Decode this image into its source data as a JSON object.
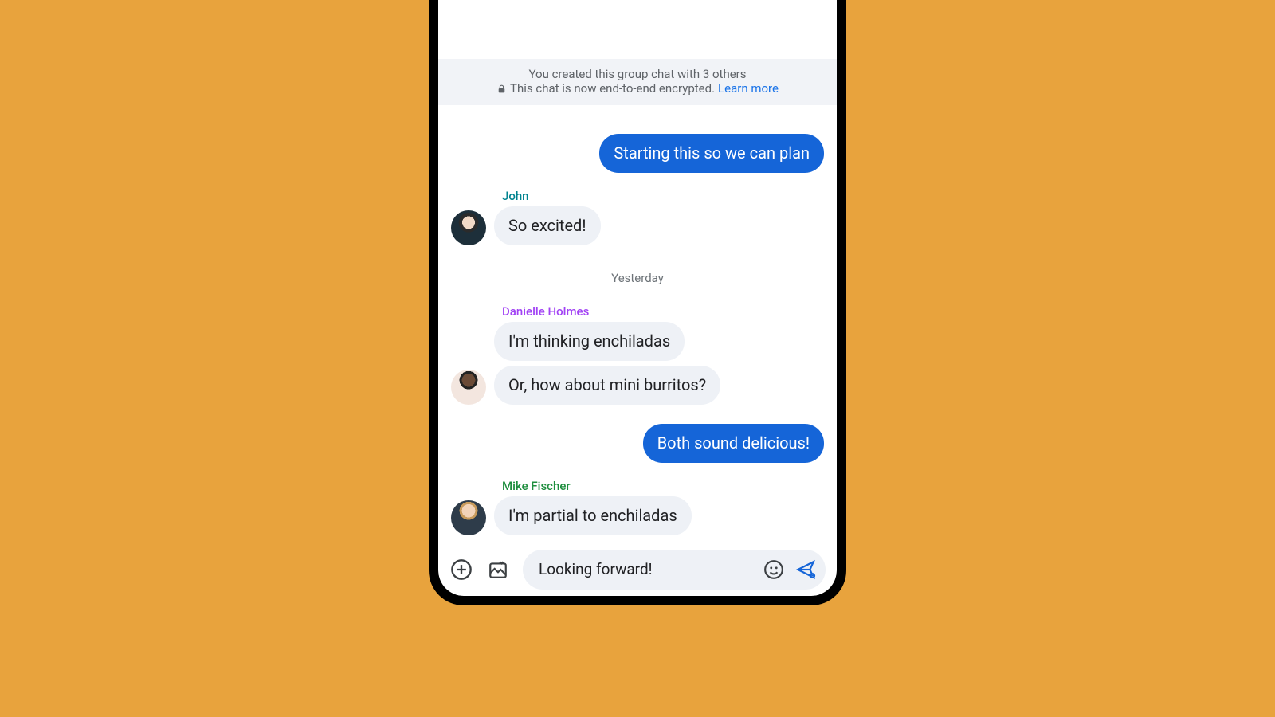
{
  "banner": {
    "line1": "You created this group chat with 3 others",
    "line2_prefix": "This chat is now end-to-end encrypted.",
    "learn_more": "Learn more"
  },
  "date_separator": "Yesterday",
  "senders": {
    "john": {
      "name": "John",
      "color": "#00838f"
    },
    "danielle": {
      "name": "Danielle Holmes",
      "color": "#a142f4"
    },
    "mike": {
      "name": "Mike Fischer",
      "color": "#1e8e3e"
    }
  },
  "messages": {
    "out1": "Starting this so we can plan",
    "john1": "So excited!",
    "danielle1": "I'm thinking enchiladas",
    "danielle2": "Or, how about mini burritos?",
    "out2": "Both sound delicious!",
    "mike1": "I'm partial to enchiladas"
  },
  "compose": {
    "text": "Looking forward!"
  }
}
